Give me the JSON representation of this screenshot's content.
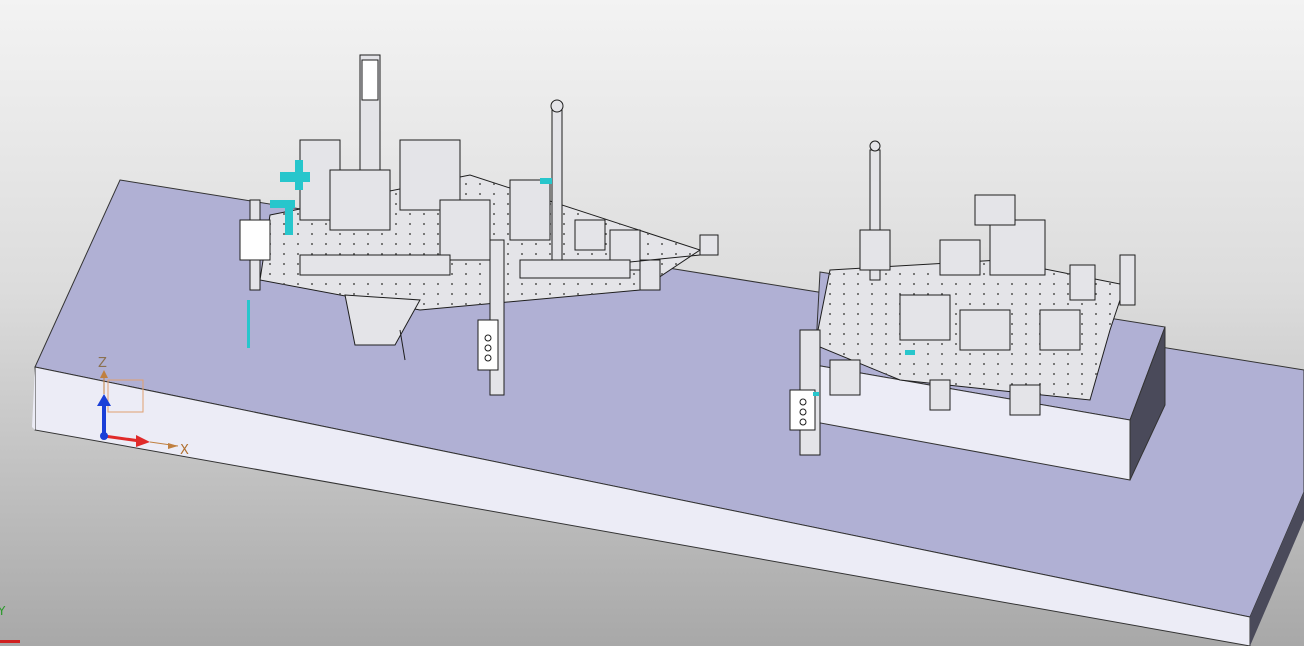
{
  "viewport": {
    "axes": {
      "z": "Z",
      "x": "X",
      "y": "Y"
    },
    "colors": {
      "background_top": "#f3f3f3",
      "background_bottom": "#a8a8a8",
      "table_top": "#b0b0d4",
      "table_front": "#ececf6",
      "table_side": "#4a4a5a",
      "highlight": "#27c6cc",
      "axis_x": "#e02a2a",
      "axis_z": "#1a3fd8"
    },
    "icons": [
      "compass-axis-icon"
    ]
  }
}
